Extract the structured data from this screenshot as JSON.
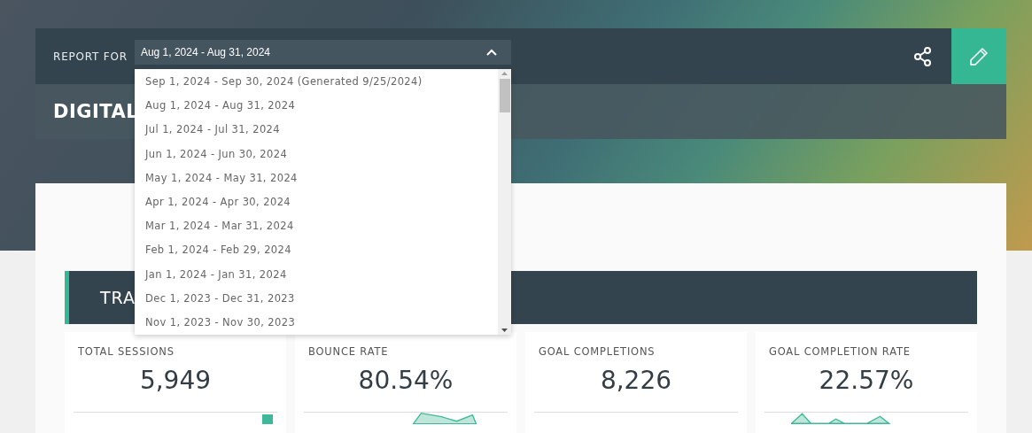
{
  "header": {
    "report_label": "REPORT FOR",
    "period": "Aug 1, 2024 - Aug 31, 2024",
    "expanded": true,
    "title": "DIGITAL"
  },
  "period_options": [
    "Sep 1, 2024 - Sep 30, 2024 (Generated 9/25/2024)",
    "Aug 1, 2024 - Aug 31, 2024",
    "Jul 1, 2024 - Jul 31, 2024",
    "Jun 1, 2024 - Jun 30, 2024",
    "May 1, 2024 - May 31, 2024",
    "Apr 1, 2024 - Apr 30, 2024",
    "Mar 1, 2024 - Mar 31, 2024",
    "Feb 1, 2024 - Feb 29, 2024",
    "Jan 1, 2024 - Jan 31, 2024",
    "Dec 1, 2023 - Dec 31, 2023",
    "Nov 1, 2023 - Nov 30, 2023"
  ],
  "section": {
    "title": "TRA"
  },
  "metrics": [
    {
      "label": "TOTAL SESSIONS",
      "value": "5,949",
      "kind": "bar"
    },
    {
      "label": "BOUNCE RATE",
      "value": "80.54%",
      "kind": "area"
    },
    {
      "label": "GOAL COMPLETIONS",
      "value": "8,226",
      "kind": "none"
    },
    {
      "label": "GOAL COMPLETION RATE",
      "value": "22.57%",
      "kind": "line"
    }
  ]
}
